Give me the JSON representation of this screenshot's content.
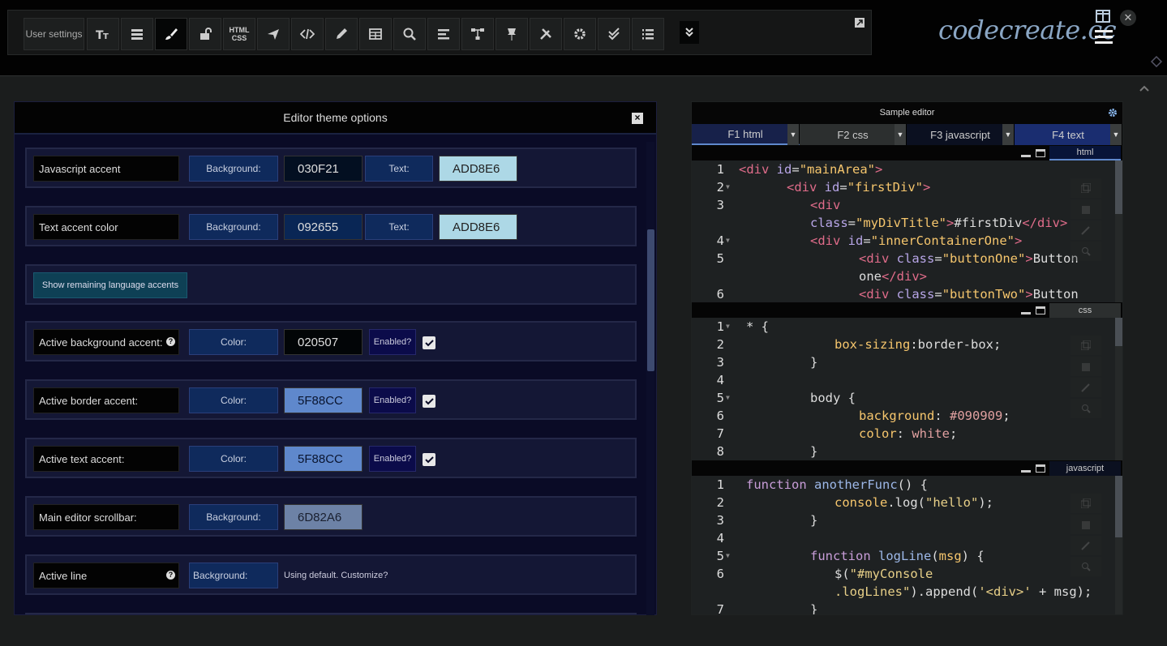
{
  "toolbar": {
    "user_settings": "User settings",
    "html_css_line1": "HTML",
    "html_css_line2": "CSS",
    "icons": [
      "text-size-icon",
      "list-icon",
      "brush-icon",
      "unlock-icon",
      "html-css-icon",
      "send-icon",
      "code-icon",
      "pen-icon",
      "table-icon",
      "search-icon",
      "align-icon",
      "hierarchy-icon",
      "pin-icon",
      "tools-icon",
      "gear-icon",
      "double-check-icon",
      "numbered-list-icon"
    ]
  },
  "logo": "codecreate.cc",
  "theme_panel": {
    "title": "Editor theme options",
    "rows": [
      {
        "label": "Javascript accent",
        "bg_label": "Background:",
        "bg_value": "030F21",
        "bg_color": "#030F21",
        "text_label": "Text:",
        "text_value": "ADD8E6",
        "text_color": "#ADD8E6"
      },
      {
        "label": "Text accent color",
        "bg_label": "Background:",
        "bg_value": "092655",
        "bg_color": "#092655",
        "text_label": "Text:",
        "text_value": "ADD8E6",
        "text_color": "#ADD8E6"
      }
    ],
    "show_button": "Show remaining language accents",
    "accents": [
      {
        "label": "Active background accent:",
        "color_label": "Color:",
        "value": "020507",
        "color": "#020507",
        "enabled_label": "Enabled?",
        "enabled": true,
        "help": true
      },
      {
        "label": "Active border accent:",
        "color_label": "Color:",
        "value": "5F88CC",
        "color": "#5F88CC",
        "enabled_label": "Enabled?",
        "enabled": true,
        "help": false
      },
      {
        "label": "Active text accent:",
        "color_label": "Color:",
        "value": "5F88CC",
        "color": "#5F88CC",
        "enabled_label": "Enabled?",
        "enabled": true,
        "help": false
      }
    ],
    "scrollbar": {
      "label": "Main editor scrollbar:",
      "bg_label": "Background:",
      "value": "6D82A6",
      "color": "#6D82A6"
    },
    "active_line": {
      "label": "Active line",
      "bg_label": "Background:",
      "note": "Using default. Customize?"
    }
  },
  "sample_editor": {
    "title": "Sample editor",
    "tabs": [
      {
        "label": "F1 html",
        "bg": "#17214a"
      },
      {
        "label": "F2 css",
        "bg": "#2c2f2f"
      },
      {
        "label": "F3 javascript",
        "bg": "#0b1020"
      },
      {
        "label": "F4 text",
        "bg": "#1a2d70"
      }
    ],
    "pane_labels": [
      "html",
      "css",
      "javascript"
    ],
    "html_lines": [
      "1",
      "2",
      "3",
      "",
      "4",
      "5",
      "",
      "6"
    ],
    "css_lines": [
      "1",
      "2",
      "3",
      "4",
      "5",
      "6",
      "7",
      "8"
    ],
    "js_lines": [
      "1",
      "2",
      "3",
      "4",
      "5",
      "6",
      "",
      "7"
    ]
  }
}
